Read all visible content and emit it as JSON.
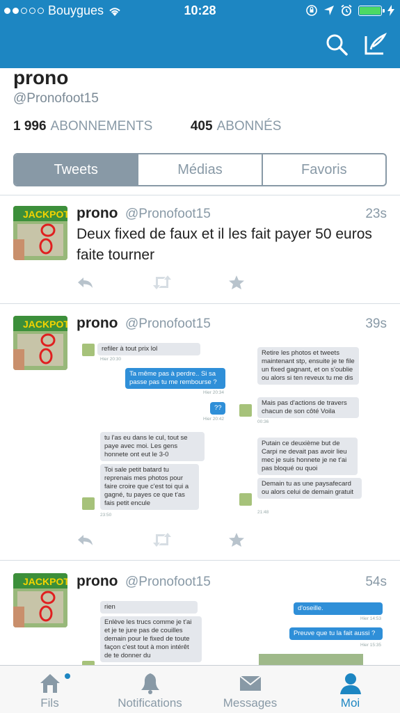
{
  "status_bar": {
    "carrier": "Bouygues",
    "time": "10:28"
  },
  "profile": {
    "name": "prono",
    "handle": "@Pronofoot15",
    "following_count": "1 996",
    "following_label": "ABONNEMENTS",
    "followers_count": "405",
    "followers_label": "ABONNÉS"
  },
  "tabs": {
    "tweets": "Tweets",
    "medias": "Médias",
    "favoris": "Favoris"
  },
  "tweets": [
    {
      "name": "prono",
      "handle": "@Pronofoot15",
      "time": "23s",
      "text": "Deux fixed de faux et il les fait payer 50 euros faite tourner"
    },
    {
      "name": "prono",
      "handle": "@Pronofoot15",
      "time": "39s",
      "chat": {
        "l1": "refiler à tout prix lol",
        "l1t": "Hier 20:30",
        "l2": "Ta même pas à perdre.. Si sa passe pas tu me rembourse ?",
        "l2t": "Hier 20:34",
        "l3": "??",
        "l3t": "Hier 20:42",
        "l4": "tu l'as eu dans le cul, tout se paye avec moi. Les gens honnete ont eut le 3-0",
        "l5": "Toi sale petit batard tu reprenais mes photos pour faire croire que c'est toi qui a gagné, tu payes ce que t'as fais petit encule",
        "l5t": "23:50",
        "r1": "Retire les photos et tweets maintenant stp, ensuite je te file un fixed gagnant, et on s'oublie ou alors si ten reveux tu me dis",
        "r2": "Mais pas d'actions de travers chacun de son côté Voila",
        "r2t": "00:36",
        "r3": "Putain ce deuxième but de Carpi ne devait pas avoir lieu mec je suis honnete je ne t'ai pas bloqué ou quoi",
        "r4": "Demain tu as une paysafecard ou alors celui de demain gratuit",
        "r4t": "21:48"
      }
    },
    {
      "name": "prono",
      "handle": "@Pronofoot15",
      "time": "54s",
      "chat": {
        "l1": "rien",
        "l2": "Enlève les trucs comme je t'ai et je te jure pas de couilles demain pour le fixed de toute façon c'est tout à mon intérêt de te donner du",
        "r1": "d'oseille.",
        "r1t": "Hier 14:53",
        "r2": "Preuve que tu la fait aussi ?",
        "r2t": "Hier 15:35"
      }
    }
  ],
  "tabbar": {
    "fils": "Fils",
    "notifications": "Notifications",
    "messages": "Messages",
    "moi": "Moi"
  },
  "colors": {
    "header": "#1d86c2",
    "muted": "#8899a6",
    "active_tab": "#1d86c2"
  }
}
